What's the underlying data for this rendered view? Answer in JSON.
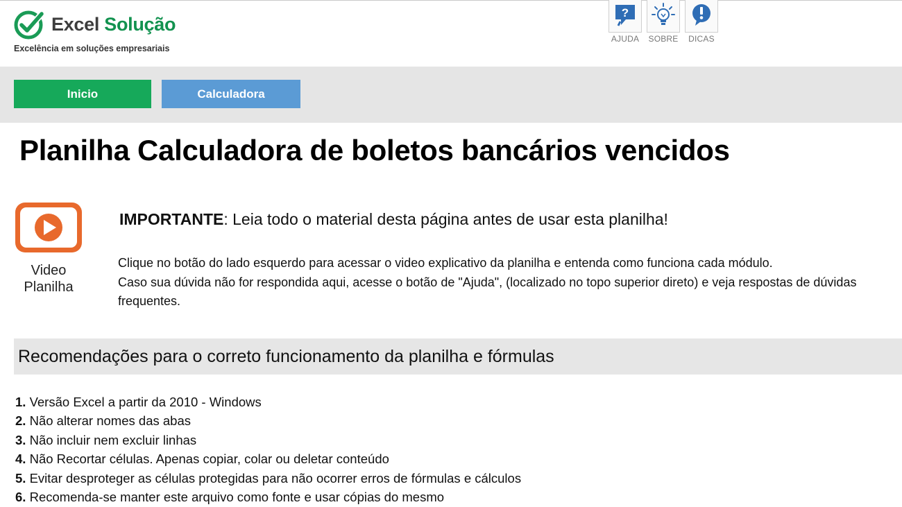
{
  "header": {
    "logo_word_1": "Excel",
    "logo_word_2": "Solução",
    "tagline": "Excelência em soluções empresariais",
    "icons": [
      {
        "name": "help-icon",
        "label": "AJUDA"
      },
      {
        "name": "lightbulb-icon",
        "label": "SOBRE"
      },
      {
        "name": "exclamation-icon",
        "label": "DICAS"
      }
    ]
  },
  "nav": {
    "inicio_label": "Inicio",
    "calculadora_label": "Calculadora"
  },
  "main": {
    "title": "Planilha Calculadora de boletos bancários vencidos",
    "video_line1": "Video",
    "video_line2": "Planilha",
    "important_label": "IMPORTANTE",
    "important_text": ": Leia todo o material desta página antes de usar esta planilha!",
    "info_line1": "Clique no botão do lado esquerdo para acessar o video explicativo da planilha e entenda como funciona cada módulo.",
    "info_line2": "Caso sua dúvida não for respondida aqui, acesse o botão de \"Ajuda\", (localizado no topo superior direto) e veja respostas de dúvidas frequentes."
  },
  "recommendations": {
    "title": "Recomendações para o correto funcionamento da planilha e fórmulas",
    "items": [
      {
        "num": "1.",
        "text": " Versão Excel a partir da 2010 - Windows"
      },
      {
        "num": "2.",
        "text": " Não alterar nomes das abas"
      },
      {
        "num": "3.",
        "text": " Não incluir nem excluir linhas"
      },
      {
        "num": "4.",
        "text": " Não Recortar células. Apenas copiar, colar ou deletar conteúdo"
      },
      {
        "num": "5.",
        "text": " Evitar desproteger as células protegidas para não ocorrer erros de fórmulas e cálculos"
      },
      {
        "num": "6.",
        "text": " Recomenda-se manter este arquivo como fonte e usar cópias do mesmo"
      }
    ]
  },
  "colors": {
    "brand_green": "#12924f",
    "nav_green": "#16a95a",
    "nav_blue": "#5b9bd5",
    "video_orange": "#e8692c",
    "icon_blue": "#2f6db5"
  }
}
